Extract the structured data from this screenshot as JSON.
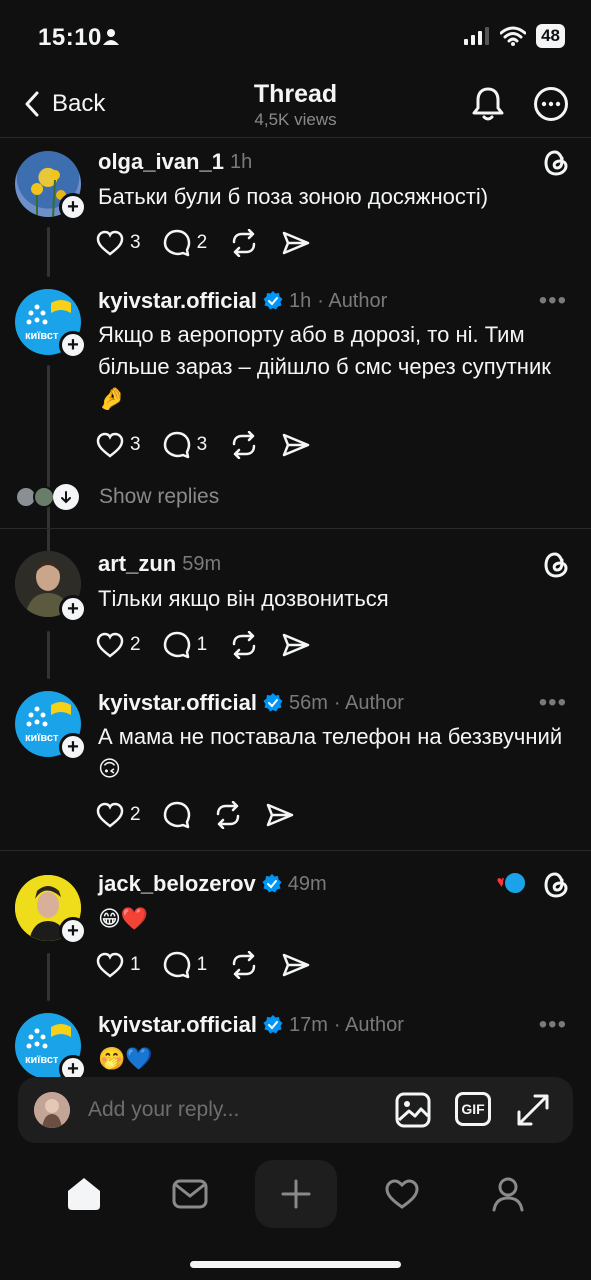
{
  "status": {
    "time": "15:10",
    "battery": "48"
  },
  "nav": {
    "back_label": "Back",
    "title": "Thread",
    "views": "4,5K views"
  },
  "posts": [
    {
      "username": "olga_ivan_1",
      "time": "1h",
      "author_tag": "",
      "text": "Батьки були б поза зоною досяжності)",
      "likes": "3",
      "replies": "2"
    },
    {
      "username": "kyivstar.official",
      "time": "1h",
      "author_tag": "· Author",
      "text": "Якщо в аеропорту або в дорозі, то ні. Тим більше зараз – дійшло б смс через супутник 🤌",
      "likes": "3",
      "replies": "3"
    },
    {
      "username": "art_zun",
      "time": "59m",
      "author_tag": "",
      "text": "Тільки якщо він дозвониться",
      "likes": "2",
      "replies": "1"
    },
    {
      "username": "kyivstar.official",
      "time": "56m",
      "author_tag": "· Author",
      "text": "А мама не поставала телефон на беззвучний 🙃",
      "likes": "2",
      "replies": ""
    },
    {
      "username": "jack_belozerov",
      "time": "49m",
      "author_tag": "",
      "text": "😁❤️",
      "likes": "1",
      "replies": "1"
    },
    {
      "username": "kyivstar.official",
      "time": "17m",
      "author_tag": "· Author",
      "text": "🤭💙",
      "likes": "",
      "replies": ""
    }
  ],
  "show_replies_label": "Show replies",
  "kyivstar_logo_text": "київст",
  "reply": {
    "placeholder": "Add your reply...",
    "gif_label": "GIF"
  },
  "colors": {
    "background": "#101010",
    "text": "#f3f5f7",
    "muted": "#7a7a7a",
    "verified": "#0095f6",
    "kyivstar_blue": "#1aa3e8",
    "kyivstar_yellow": "#f7d117"
  }
}
